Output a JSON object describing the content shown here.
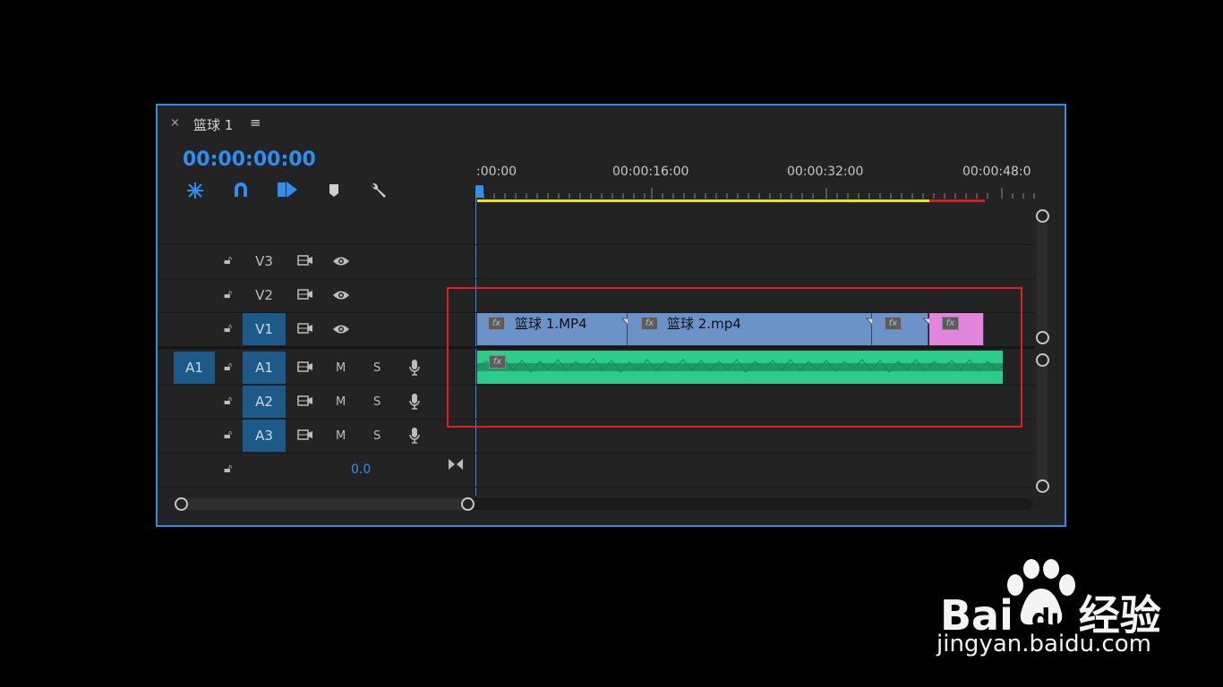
{
  "sequence": {
    "close_label": "×",
    "title": "篮球 1",
    "menu_label": "≡",
    "timecode": "00:00:00:00"
  },
  "ruler": {
    "labels": [
      ":00:00",
      "00:00:16:00",
      "00:00:32:00",
      "00:00:48:0"
    ]
  },
  "tracks": {
    "video": [
      {
        "label": "V3",
        "visibility": "eye"
      },
      {
        "label": "V2",
        "visibility": "eye"
      },
      {
        "label": "V1",
        "visibility": "eye"
      }
    ],
    "audio": [
      {
        "label": "A1",
        "source": "A1",
        "mute": "M",
        "solo": "S"
      },
      {
        "label": "A2",
        "mute": "M",
        "solo": "S"
      },
      {
        "label": "A3",
        "mute": "M",
        "solo": "S"
      }
    ],
    "mix_value": "0.0"
  },
  "clips": {
    "fx_label": "fx",
    "clip1_name": "篮球 1.MP4",
    "clip2_name": "篮球 2.mp4"
  },
  "colors": {
    "accent": "#2e8ff0",
    "clip_video": "#6b93c9",
    "clip_pink": "#e286dd",
    "audio_wave": "#2ecc8a",
    "work_area": "#e6e613",
    "render_red": "#d12323",
    "highlight_box": "#e02020"
  },
  "watermark": {
    "brand": "Bai",
    "brand_mid": "du",
    "brand_cn": "经验",
    "url": "jingyan.baidu.com"
  }
}
